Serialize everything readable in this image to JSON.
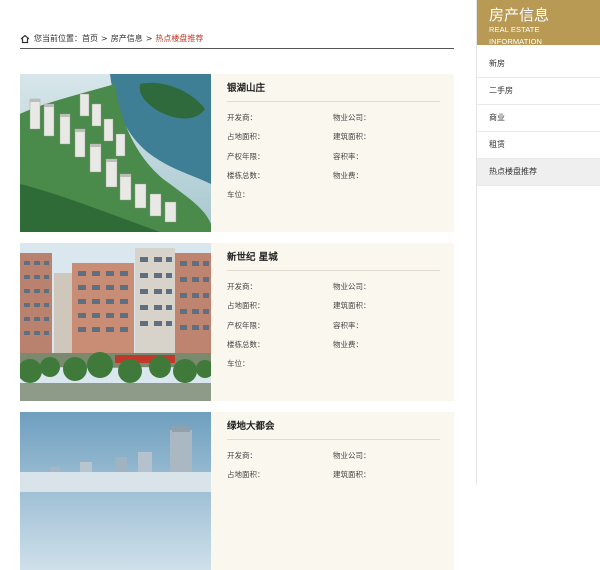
{
  "breadcrumb": {
    "prefix": "您当前位置：",
    "items": [
      "首页",
      "房产信息",
      "热点楼盘推荐"
    ],
    "separator": ">"
  },
  "sidebar": {
    "title": "房产信息",
    "subtitle": "REAL ESTATE INFORMATION",
    "items": [
      {
        "label": "新房"
      },
      {
        "label": "二手房"
      },
      {
        "label": "商业"
      },
      {
        "label": "租赁"
      },
      {
        "label": "热点楼盘推荐",
        "active": true
      }
    ]
  },
  "listing_labels": {
    "developer": "开发商：",
    "property_company": "物业公司：",
    "land_area": "占地面积：",
    "building_area": "建筑面积：",
    "property_term": "产权年限：",
    "plot_ratio": "容积率：",
    "total_buildings": "楼栋总数：",
    "property_fee": "物业费：",
    "parking": "车位："
  },
  "listings": [
    {
      "name": "银湖山庄"
    },
    {
      "name": "新世纪 星城"
    },
    {
      "name": "绿地大都会"
    }
  ],
  "colors": {
    "sidebar_header": "#b89a55",
    "listing_bg": "#faf7ef",
    "breadcrumb_current": "#c0392b"
  }
}
